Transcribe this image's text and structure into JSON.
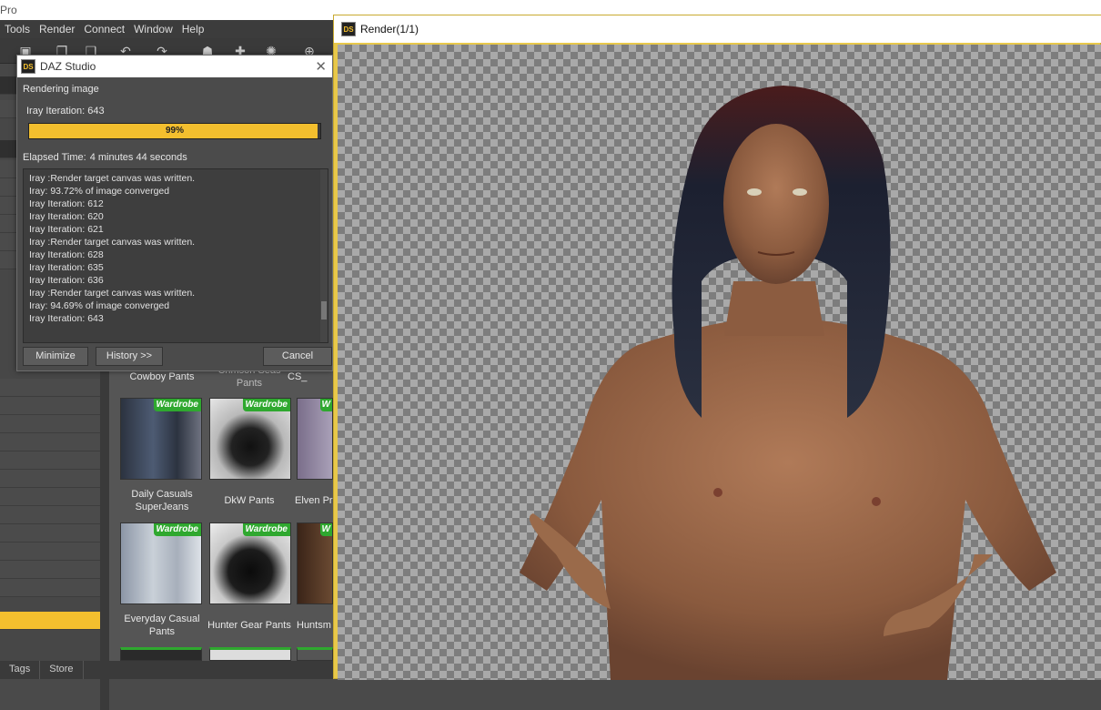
{
  "app": {
    "title": "Pro",
    "menu": [
      "Tools",
      "Render",
      "Connect",
      "Window",
      "Help"
    ],
    "bottom_tabs": [
      "Tags",
      "Store"
    ]
  },
  "dialog": {
    "title": "DAZ Studio",
    "status": "Rendering image",
    "iteration": "Iray Iteration: 643",
    "progress_percent": 99,
    "progress_label": "99%",
    "elapsed_label": "Elapsed Time:",
    "elapsed_value": "4 minutes 44 seconds",
    "log": [
      "Iray :Render target canvas was written.",
      "Iray: 93.72% of image converged",
      "Iray Iteration: 612",
      "Iray Iteration: 620",
      "Iray Iteration: 621",
      "Iray :Render target canvas was written.",
      "Iray Iteration: 628",
      "Iray Iteration: 635",
      "Iray Iteration: 636",
      "Iray :Render target canvas was written.",
      "Iray: 94.69% of image converged",
      "Iray Iteration: 643"
    ],
    "buttons": {
      "minimize": "Minimize",
      "history": "History >>",
      "cancel": "Cancel"
    }
  },
  "content": {
    "top_labels": [
      "Cowboy Pants",
      "Crimson Seas Pants",
      "CS_"
    ],
    "badge": "Wardrobe",
    "tiles": [
      {
        "label": "Daily Casuals SuperJeans"
      },
      {
        "label": "DkW Pants"
      },
      {
        "label": "Elven Pr"
      },
      {
        "label": "Everyday Casual Pants"
      },
      {
        "label": "Hunter Gear Pants"
      },
      {
        "label": "Huntsm"
      }
    ]
  },
  "render_window": {
    "title": "Render(1/1)",
    "logo": "DS"
  },
  "colors": {
    "accent": "#f3bf2e",
    "badge_green": "#2fa82f"
  }
}
